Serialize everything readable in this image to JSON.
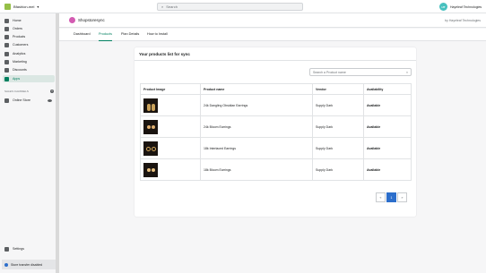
{
  "topbar": {
    "store": "Bfashion-mel",
    "search_placeholder": "Search",
    "user_initials": "HT",
    "user_name": "Hayeleaf Technologies"
  },
  "sidebar": {
    "items": [
      {
        "label": "Home",
        "icon": "home-icon"
      },
      {
        "label": "Orders",
        "icon": "orders-icon"
      },
      {
        "label": "Products",
        "icon": "tag-icon"
      },
      {
        "label": "Customers",
        "icon": "customers-icon"
      },
      {
        "label": "Analytics",
        "icon": "analytics-icon"
      },
      {
        "label": "Marketing",
        "icon": "marketing-icon"
      },
      {
        "label": "Discounts",
        "icon": "discounts-icon"
      },
      {
        "label": "Apps",
        "icon": "apps-icon",
        "active": true
      }
    ],
    "sales_channels_heading": "SALES CHANNELS",
    "online_store": "Online Store",
    "settings": "Settings",
    "store_transfer": "Store transfer disabled"
  },
  "app": {
    "name": "Shopstoresync",
    "by": "by Hayeleaf Technologies",
    "tabs": [
      "Dashboard",
      "Products",
      "Plan Details",
      "How to Install"
    ],
    "active_tab": "Products"
  },
  "card": {
    "title": "Your products list for sync",
    "search_placeholder": "Search a Product name",
    "clear_icon": "×",
    "columns": [
      "Product Image",
      "Product name",
      "Vendor",
      "Availability"
    ],
    "rows": [
      {
        "name": "24k Dangling Obsidian Earrings",
        "vendor": "Supply Dark",
        "availability": "Available",
        "image": "dangling-earrings-thumb"
      },
      {
        "name": "24k Bloom Earrings",
        "vendor": "Supply Dark",
        "availability": "Available",
        "image": "bloom-earrings-thumb"
      },
      {
        "name": "18k Interlaced Earrings",
        "vendor": "Supply Dark",
        "availability": "Available",
        "image": "interlaced-earrings-thumb"
      },
      {
        "name": "18k Bloom Earrings",
        "vendor": "Supply Dark",
        "availability": "Available",
        "image": "bloom-earrings-thumb"
      }
    ],
    "pagination": {
      "prev": "«",
      "current": "1",
      "next": "»"
    }
  },
  "colors": {
    "accent": "#007f5f",
    "page_active": "#2c6ecb"
  }
}
